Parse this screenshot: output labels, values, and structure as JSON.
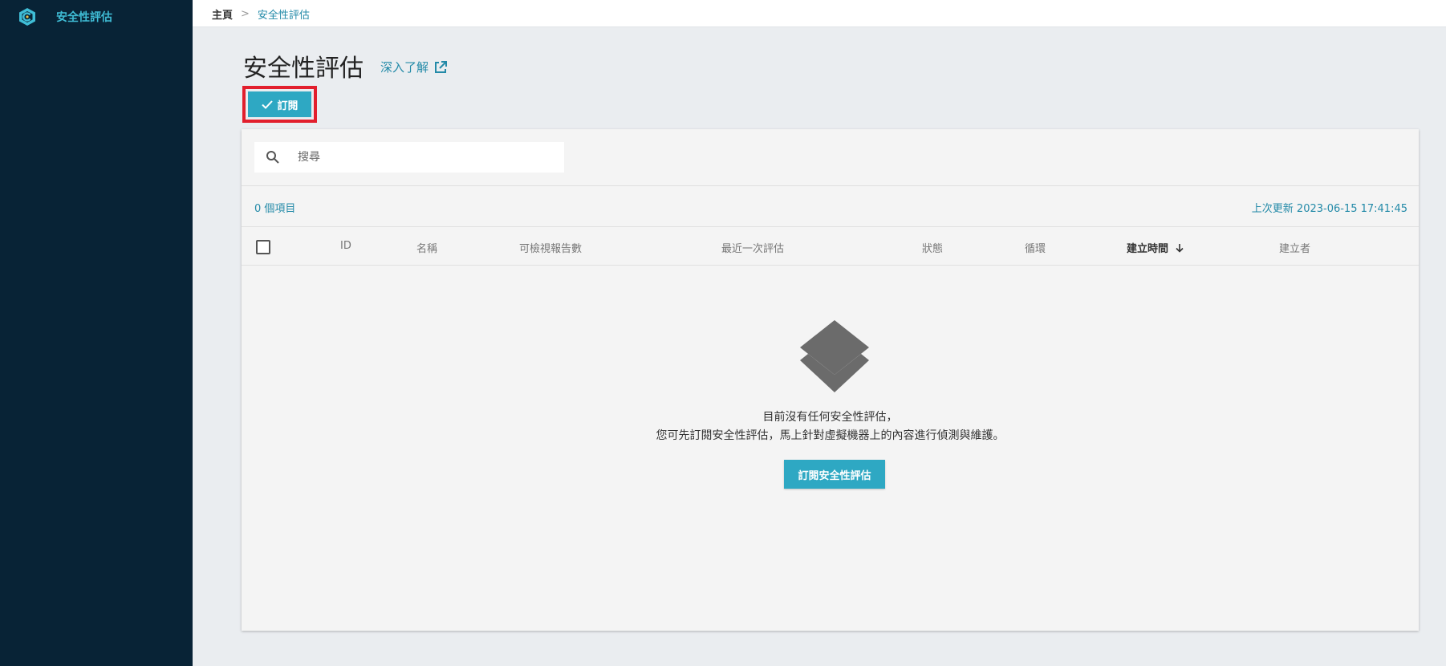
{
  "sidebar": {
    "logo_icon": "hexagon-logo-icon",
    "title": "安全性評估"
  },
  "breadcrumb": {
    "home": "主頁",
    "separator": ">",
    "current": "安全性評估"
  },
  "page": {
    "title": "安全性評估",
    "learn_more": "深入了解",
    "learn_more_icon": "external-link-icon"
  },
  "toolbar": {
    "subscribe_label": "訂閱",
    "subscribe_icon": "check-icon"
  },
  "search": {
    "placeholder": "搜尋",
    "value": ""
  },
  "summary": {
    "item_count": "0 個項目",
    "last_update": "上次更新 2023-06-15 17:41:45"
  },
  "table": {
    "columns": [
      "ID",
      "名稱",
      "可檢視報告數",
      "最近一次評估",
      "狀態",
      "循環",
      "建立時間",
      "建立者"
    ],
    "sorted_column_index": 6,
    "sort_direction": "descending"
  },
  "empty_state": {
    "icon": "layers-icon",
    "line1": "目前沒有任何安全性評估，",
    "line2": "您可先訂閱安全性評估，馬上針對虛擬機器上的內容進行偵測與維護。",
    "button_label": "訂閱安全性評估"
  },
  "colors": {
    "sidebar_bg": "#082336",
    "accent": "#2ea8c3",
    "link": "#238aa8",
    "highlight_border": "#e21f2d",
    "page_bg": "#eaedf0"
  }
}
